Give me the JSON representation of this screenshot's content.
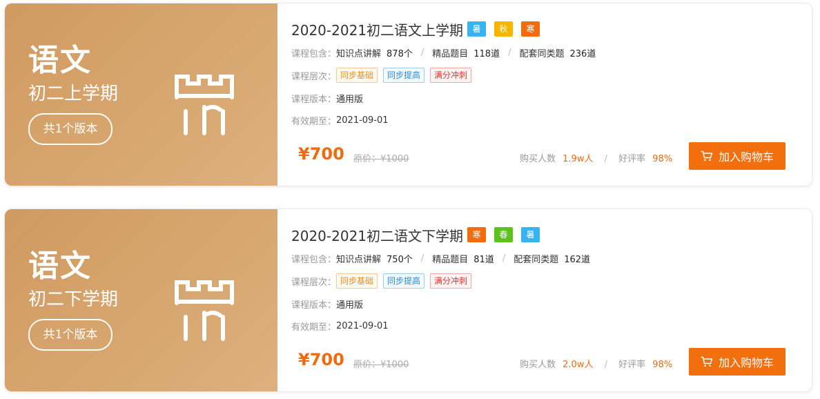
{
  "courses": [
    {
      "subject": "语文",
      "term": "初二上学期",
      "version_count": "共1个版本",
      "title": "2020-2021初二语文上学期",
      "seasons": [
        "暑",
        "秋",
        "寒"
      ],
      "contents_label": "课程包含：",
      "knowledge_label": "知识点讲解",
      "knowledge_count": "878个",
      "premium_label": "精品题目",
      "premium_count": "118道",
      "similar_label": "配套同类题",
      "similar_count": "236道",
      "level_label": "课程层次：",
      "levels": [
        "同步基础",
        "同步提高",
        "满分冲刺"
      ],
      "edition_label": "课程版本：",
      "edition": "通用版",
      "expiry_label": "有效期至：",
      "expiry": "2021-09-01",
      "price": "¥700",
      "original_price": "原价：¥1000",
      "buyers_label": "购买人数",
      "buyers": "1.9w人",
      "rating_label": "好评率",
      "rating": "98%",
      "cart_label": "加入购物车"
    },
    {
      "subject": "语文",
      "term": "初二下学期",
      "version_count": "共1个版本",
      "title": "2020-2021初二语文下学期",
      "seasons": [
        "寒",
        "春",
        "暑"
      ],
      "contents_label": "课程包含：",
      "knowledge_label": "知识点讲解",
      "knowledge_count": "750个",
      "premium_label": "精品题目",
      "premium_count": "81道",
      "similar_label": "配套同类题",
      "similar_count": "162道",
      "level_label": "课程层次：",
      "levels": [
        "同步基础",
        "同步提高",
        "满分冲刺"
      ],
      "edition_label": "课程版本：",
      "edition": "通用版",
      "expiry_label": "有效期至：",
      "expiry": "2021-09-01",
      "price": "¥700",
      "original_price": "原价：¥1000",
      "buyers_label": "购买人数",
      "buyers": "2.0w人",
      "rating_label": "好评率",
      "rating": "98%",
      "cart_label": "加入购物车"
    }
  ],
  "colors": {
    "cover_start": "#d09a5f",
    "cover_end": "#ddb07d",
    "accent": "#f36e0c",
    "summer": "#36b4f2",
    "autumn": "#f7b500",
    "winter": "#f46c0a",
    "spring": "#5ac41b"
  }
}
